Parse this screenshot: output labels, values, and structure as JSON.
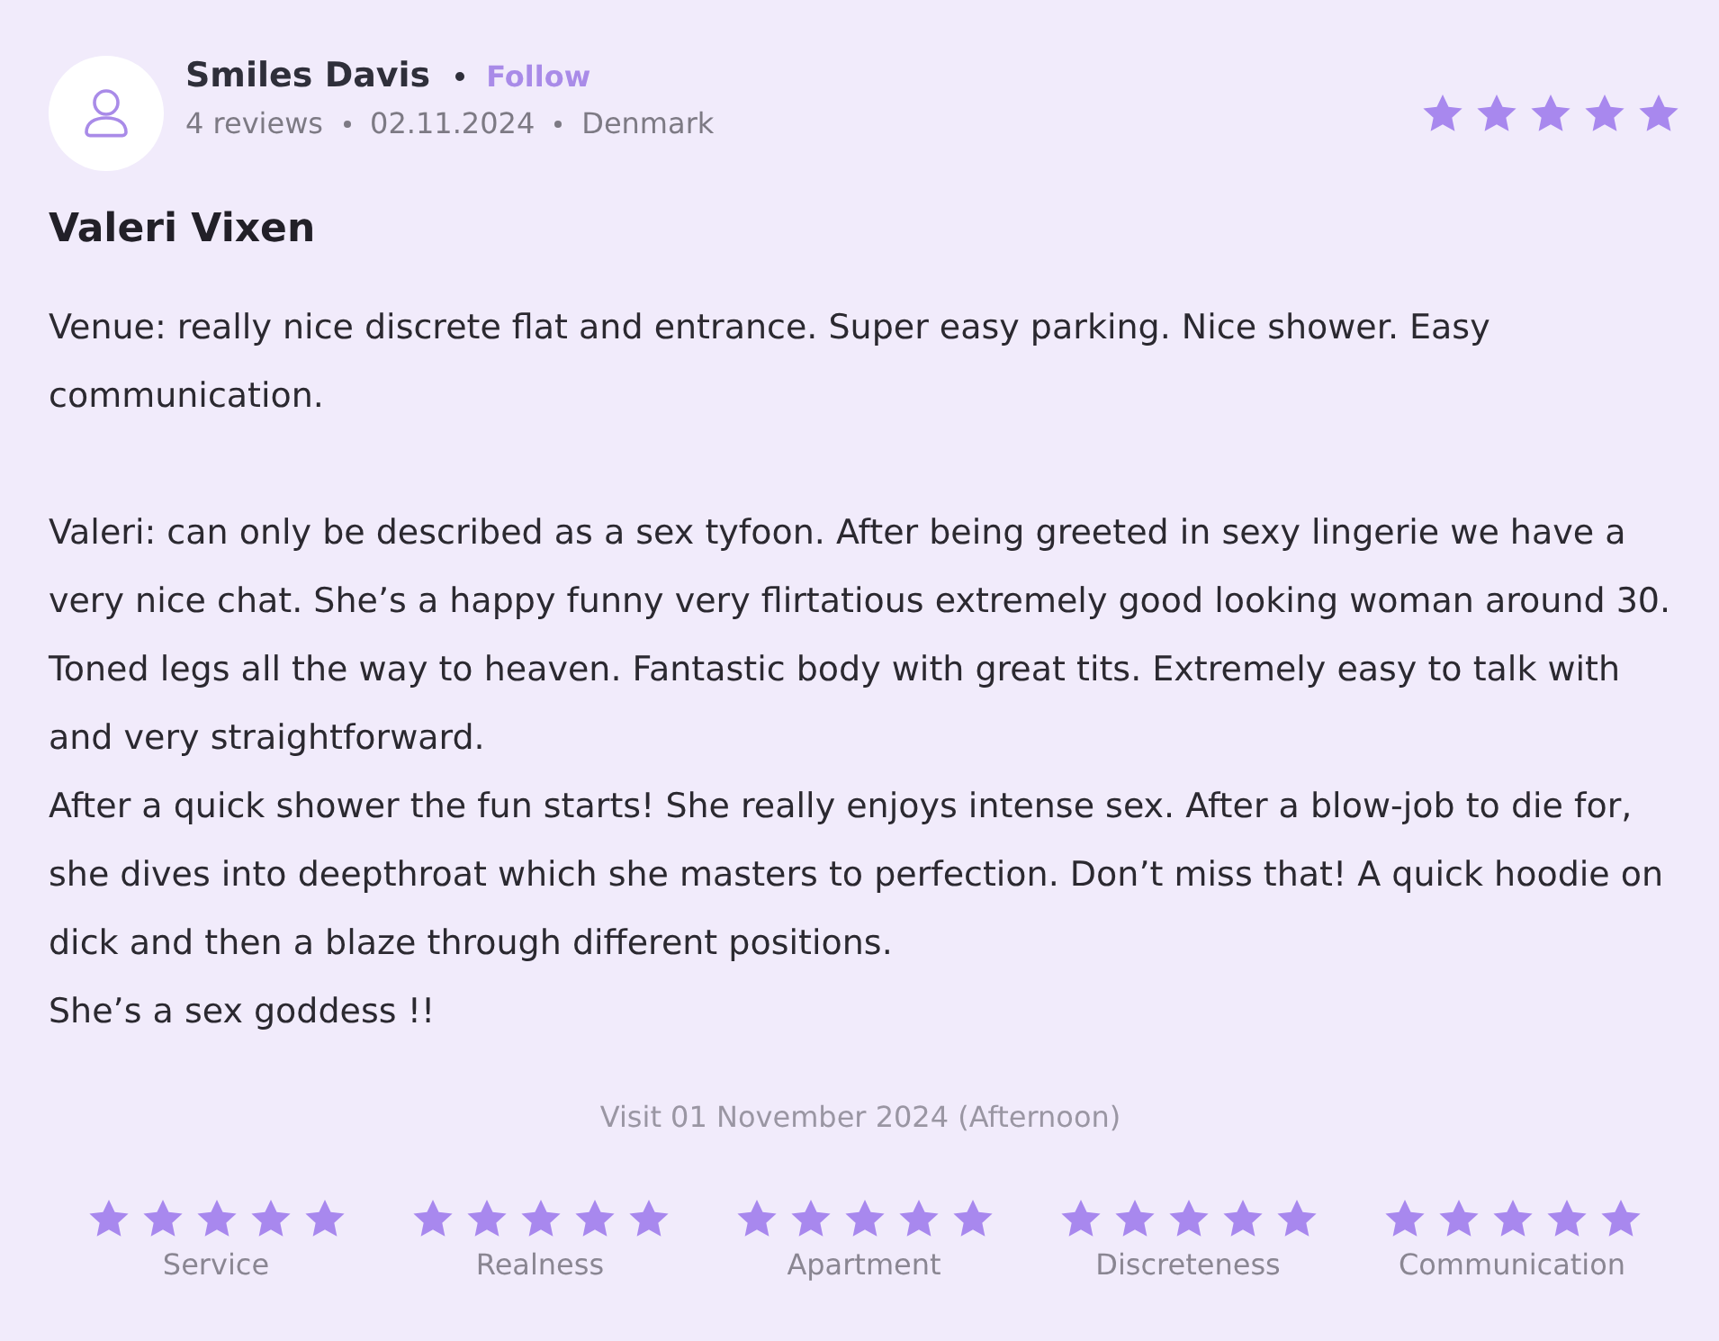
{
  "review": {
    "author": {
      "name": "Smiles Davis",
      "follow": "Follow",
      "reviews": "4 reviews",
      "date": "02.11.2024",
      "country": "Denmark"
    },
    "stars": 5,
    "title": "Valeri Vixen",
    "text": "Venue: really nice discrete flat and entrance. Super easy parking. Nice shower. Easy communication.\n\nValeri: can only be described as a sex tyfoon. After being greeted in sexy lingerie we have a very nice chat. She’s a happy funny very flirtatious extremely good looking woman around 30. Toned legs all the way to heaven. Fantastic body with great tits. Extremely easy to talk with and very straightforward.\nAfter a quick shower the fun starts! She really enjoys intense sex. After a blow-job to die for, she dives into deepthroat which she masters to perfection. Don’t miss that! A quick hoodie on dick and then a blaze through different positions.\nShe’s a sex goddess !!",
    "visit": "Visit 01 November 2024 (Afternoon)",
    "ratings": [
      {
        "label": "Service",
        "stars": 5
      },
      {
        "label": "Realness",
        "stars": 5
      },
      {
        "label": "Apartment",
        "stars": 5
      },
      {
        "label": "Discreteness",
        "stars": 5
      },
      {
        "label": "Communication",
        "stars": 5
      }
    ]
  }
}
